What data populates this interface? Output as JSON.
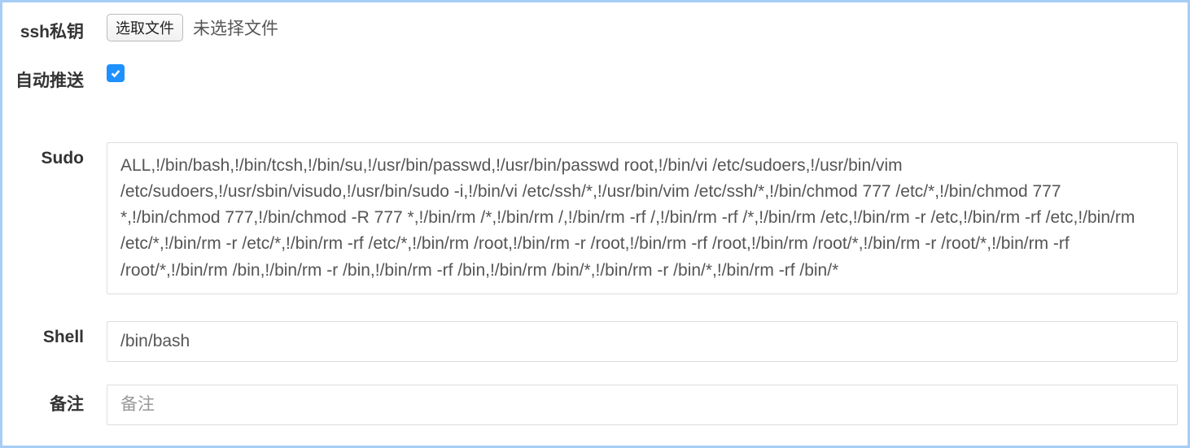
{
  "fields": {
    "ssh_key": {
      "label": "ssh私钥",
      "button_label": "选取文件",
      "status": "未选择文件"
    },
    "auto_push": {
      "label": "自动推送",
      "checked": true
    },
    "sudo": {
      "label": "Sudo",
      "value": "ALL,!/bin/bash,!/bin/tcsh,!/bin/su,!/usr/bin/passwd,!/usr/bin/passwd root,!/bin/vi /etc/sudoers,!/usr/bin/vim /etc/sudoers,!/usr/sbin/visudo,!/usr/bin/sudo -i,!/bin/vi /etc/ssh/*,!/usr/bin/vim /etc/ssh/*,!/bin/chmod 777 /etc/*,!/bin/chmod 777 *,!/bin/chmod 777,!/bin/chmod -R 777 *,!/bin/rm /*,!/bin/rm /,!/bin/rm -rf /,!/bin/rm -rf /*,!/bin/rm /etc,!/bin/rm -r /etc,!/bin/rm -rf /etc,!/bin/rm /etc/*,!/bin/rm -r /etc/*,!/bin/rm -rf /etc/*,!/bin/rm /root,!/bin/rm -r /root,!/bin/rm -rf /root,!/bin/rm /root/*,!/bin/rm -r /root/*,!/bin/rm -rf /root/*,!/bin/rm /bin,!/bin/rm -r /bin,!/bin/rm -rf /bin,!/bin/rm /bin/*,!/bin/rm -r /bin/*,!/bin/rm -rf /bin/*"
    },
    "shell": {
      "label": "Shell",
      "value": "/bin/bash"
    },
    "remark": {
      "label": "备注",
      "placeholder": "备注",
      "value": ""
    }
  }
}
